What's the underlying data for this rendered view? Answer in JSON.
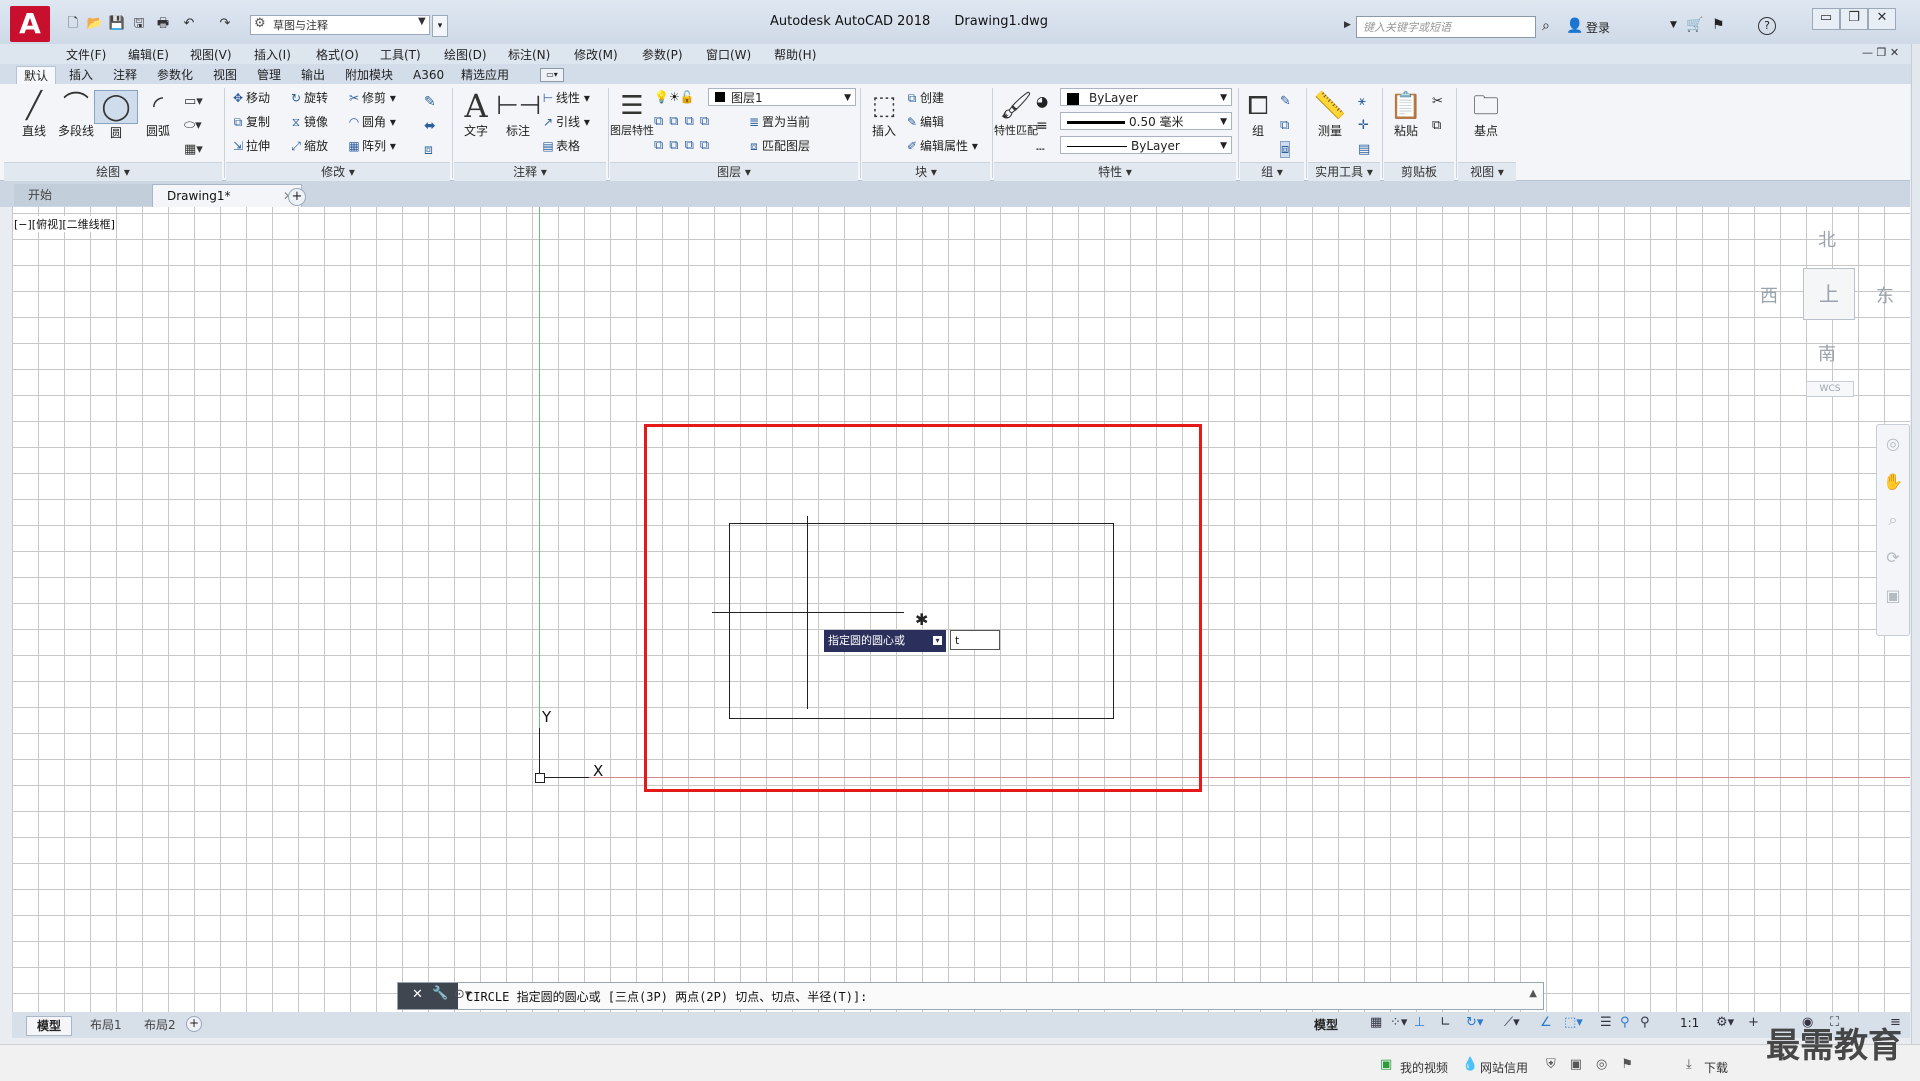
{
  "title_bar": {
    "logo_letter": "A",
    "workspace": "草图与注释",
    "app_name": "Autodesk AutoCAD 2018",
    "file_name": "Drawing1.dwg",
    "search_placeholder": "键入关键字或短语",
    "login": "登录",
    "help": "?"
  },
  "menu": [
    "文件(F)",
    "编辑(E)",
    "视图(V)",
    "插入(I)",
    "格式(O)",
    "工具(T)",
    "绘图(D)",
    "标注(N)",
    "修改(M)",
    "参数(P)",
    "窗口(W)",
    "帮助(H)"
  ],
  "ribbon_tabs": [
    "默认",
    "插入",
    "注释",
    "参数化",
    "视图",
    "管理",
    "输出",
    "附加模块",
    "A360",
    "精选应用"
  ],
  "ribbon": {
    "draw": {
      "title": "绘图",
      "line": "直线",
      "polyline": "多段线",
      "circle": "圆",
      "arc": "圆弧"
    },
    "modify": {
      "title": "修改",
      "move": "移动",
      "rotate": "旋转",
      "trim": "修剪",
      "copy": "复制",
      "mirror": "镜像",
      "fillet": "圆角",
      "stretch": "拉伸",
      "scale": "缩放",
      "array": "阵列"
    },
    "annotation": {
      "title": "注释",
      "text": "文字",
      "dimension": "标注",
      "linear": "线性",
      "leader": "引线",
      "table": "表格"
    },
    "layers": {
      "title": "图层",
      "layer_props": "图层特性",
      "current_layer": "图层1",
      "set_current": "置为当前",
      "match_layer": "匹配图层"
    },
    "block": {
      "title": "块",
      "insert": "插入",
      "create": "创建",
      "edit": "编辑",
      "edit_attr": "编辑属性"
    },
    "properties": {
      "title": "特性",
      "match": "特性匹配",
      "color": "ByLayer",
      "lineweight": "0.50 毫米",
      "linetype": "ByLayer"
    },
    "groups": {
      "title": "组",
      "group": "组"
    },
    "utilities": {
      "title": "实用工具",
      "measure": "测量"
    },
    "clipboard": {
      "title": "剪贴板",
      "paste": "粘贴"
    },
    "view": {
      "title": "视图",
      "base": "基点"
    }
  },
  "doc_tabs": {
    "start": "开始",
    "drawing": "Drawing1*"
  },
  "canvas": {
    "view_label": "[−][俯视][二维线框]",
    "ucs_x": "X",
    "ucs_y": "Y",
    "prompt_tip": "指定圆的圆心或",
    "prompt_value": "t"
  },
  "viewcube": {
    "north": "北",
    "south": "南",
    "east": "东",
    "west": "西",
    "face": "上",
    "wcs": "WCS"
  },
  "command_line": "CIRCLE 指定圆的圆心或 [三点(3P) 两点(2P) 切点、切点、半径(T)]:",
  "layout_tabs": [
    "模型",
    "布局1",
    "布局2"
  ],
  "status": {
    "model": "模型",
    "scale": "1:1"
  },
  "bottom_strip": {
    "video": "我的视频",
    "credit": "网站信用",
    "download": "下载"
  },
  "watermark": "最需教育",
  "colors": {
    "accent_red": "#e61919",
    "logo_red": "#c8102e",
    "tooltip_bg": "#2b2f5c"
  }
}
